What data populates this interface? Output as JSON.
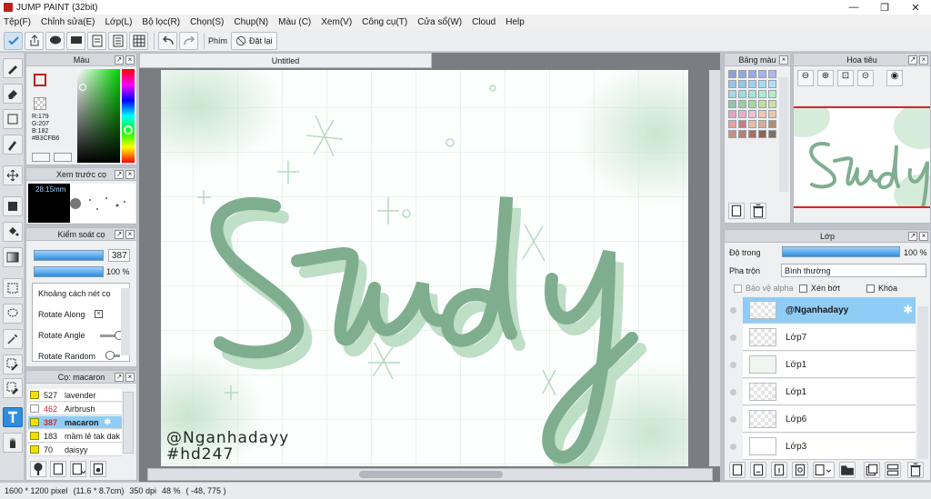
{
  "window": {
    "title": "JUMP PAINT (32bit)",
    "minimize": "—",
    "maximize": "❐",
    "close": "✕"
  },
  "menu": [
    "Tệp(F)",
    "Chỉnh sửa(E)",
    "Lớp(L)",
    "Bộ lọc(R)",
    "Chọn(S)",
    "Chụp(N)",
    "Màu (C)",
    "Xem(V)",
    "Công cụ(T)",
    "Cửa sổ(W)",
    "Cloud",
    "Help"
  ],
  "toolbar": {
    "phim_label": "Phím",
    "reset_label": "Đặt lại"
  },
  "color_panel": {
    "title": "Màu",
    "r": "R:179",
    "g": "G:207",
    "b": "B:182",
    "hex": "#B3CFB6",
    "fg_color": "#B3CFB6"
  },
  "preview_panel": {
    "title": "Xem trước cọ",
    "size": "28.15mm"
  },
  "brush_control": {
    "title": "Kiểm soát cọ",
    "size_value": "387",
    "opacity_value": "100 %",
    "spacing_label": "Khoảng cách nét cọ",
    "rotate_along_label": "Rotate Along",
    "rotate_angle_label": "Rotate Angle",
    "rotate_random_label": "Rotate Random"
  },
  "brush_list": {
    "title": "Cọ: macaron",
    "items": [
      {
        "num": "527",
        "name": "lavender"
      },
      {
        "num": "462",
        "name": "Airbrush"
      },
      {
        "num": "387",
        "name": "macaron"
      },
      {
        "num": "183",
        "name": "mầm lẻ tak dak"
      },
      {
        "num": "70",
        "name": "daisyy"
      }
    ]
  },
  "document": {
    "tab_title": "Untitled",
    "artwork_text": "Study",
    "watermark_line1": "@Nganhadayy",
    "watermark_line2": "#hd247"
  },
  "palette_panel": {
    "title": "Bảng màu",
    "colors": [
      "#8fa0d8",
      "#8fa8e0",
      "#98a8e8",
      "#a8b0f0",
      "#b0b8f0",
      "#98c0f0",
      "#90c8f0",
      "#a0d0f8",
      "#a8d8f8",
      "#b0e0f8",
      "#a8d8e8",
      "#98e0e0",
      "#a0e8d8",
      "#a8f0d0",
      "#b0f0c8",
      "#90c8a8",
      "#98d0a0",
      "#a8d8a0",
      "#c0e0a0",
      "#d0e0a0",
      "#e0a8c0",
      "#e8b0c8",
      "#f0c0d0",
      "#f0c8b0",
      "#e8c8a8",
      "#e8a0a0",
      "#c08080",
      "#e8c0a0",
      "#d0b090",
      "#b09070",
      "#c89080",
      "#b88070",
      "#a87060",
      "#906050",
      "#807060"
    ]
  },
  "navigator_panel": {
    "title": "Hoa tiêu"
  },
  "layers_panel": {
    "title": "Lớp",
    "opacity_label": "Độ trong",
    "opacity_value": "100 %",
    "blend_label": "Pha trộn",
    "blend_value": "Bình thường",
    "protect_alpha": "Bảo vệ alpha",
    "clip": "Xén bớt",
    "lock": "Khóa",
    "layers": [
      {
        "name": "@Nganhadayy",
        "selected": true
      },
      {
        "name": "Lớp7",
        "selected": false
      },
      {
        "name": "Lớp1",
        "selected": false
      },
      {
        "name": "Lớp1",
        "selected": false
      },
      {
        "name": "Lớp6",
        "selected": false
      },
      {
        "name": "Lớp3",
        "selected": false
      }
    ]
  },
  "status": {
    "size": "1600 * 1200 pixel",
    "dims": "(11.6 * 8.7cm)",
    "dpi": "350 dpi",
    "zoom": "48 %",
    "coords": "( -48, 775 )"
  }
}
